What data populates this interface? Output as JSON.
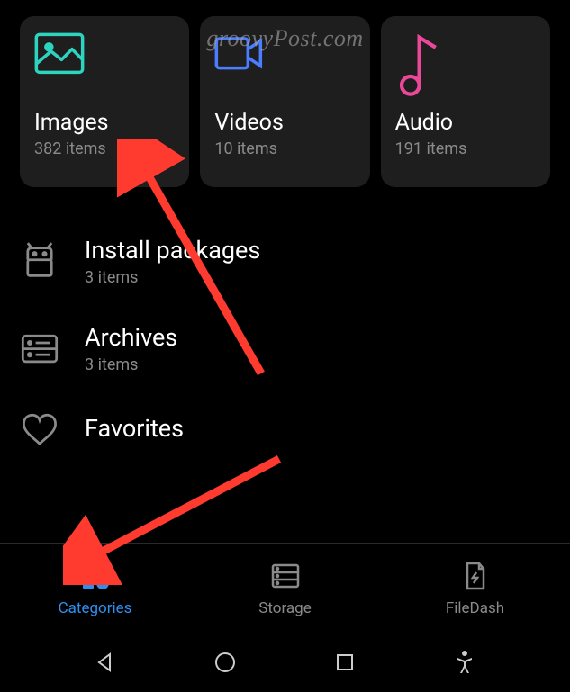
{
  "watermark": "groovyPost.com",
  "cards": {
    "images": {
      "title": "Images",
      "count": "382 items"
    },
    "videos": {
      "title": "Videos",
      "count": "10 items"
    },
    "audio": {
      "title": "Audio",
      "count": "191 items"
    }
  },
  "list": {
    "install_packages": {
      "title": "Install packages",
      "count": "3 items"
    },
    "archives": {
      "title": "Archives",
      "count": "3 items"
    },
    "favorites": {
      "title": "Favorites"
    }
  },
  "nav": {
    "categories": "Categories",
    "storage": "Storage",
    "filedash": "FileDash"
  }
}
